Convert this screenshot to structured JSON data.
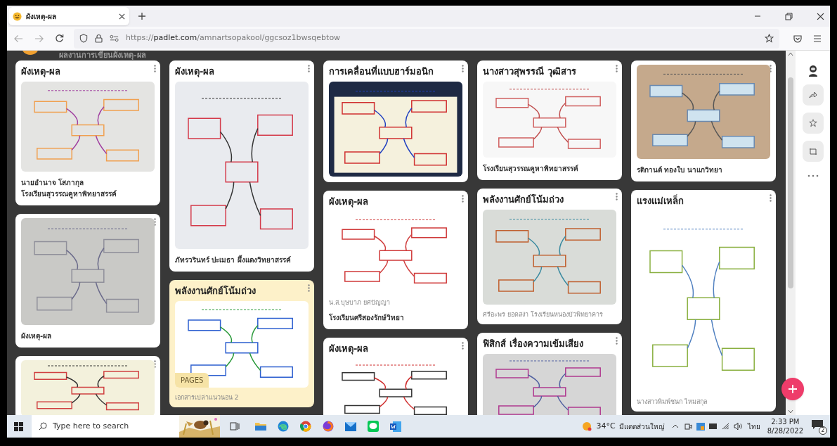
{
  "browser": {
    "tab": {
      "title": "ผังเหตุ-ผล",
      "selected": true
    },
    "url": "https://**padlet.com**/amnartsopakool/ggcsoz1bwsqebtow"
  },
  "board": {
    "subtitle": "ผลงานการเขียนผังเหตุ-ผล",
    "columns": [
      {
        "posts": [
          {
            "title": "ผังเหตุ-ผล",
            "image": {
              "kind": "picture"
            },
            "caption": [
              "นายอำนาจ โสภากุล",
              "โรงเรียนสุวรรณคูหาพิทยาสรรค์"
            ]
          },
          {
            "image": {
              "kind": "picture"
            },
            "caption": [
              "ผังเหตุ-ผล"
            ]
          },
          {
            "image": {
              "kind": "picture"
            }
          }
        ]
      },
      {
        "posts": [
          {
            "title": "ผังเหตุ-ผล",
            "image": {
              "kind": "picture"
            },
            "caption": [
              "ภัทรวรินทร์ ปะเมธา ผึ้งแดงวิทยาสรรค์"
            ]
          },
          {
            "title": "พลังงานศักย์โน้มถ่วง",
            "color": "#fdf1c9",
            "image": {
              "kind": "picture"
            },
            "badge": "PAGES",
            "note": "เอกสารเปล่าแนวนอน 2"
          }
        ]
      },
      {
        "posts": [
          {
            "title": "การเคลื่อนที่แบบฮาร์มอนิก",
            "image": {
              "kind": "picture"
            }
          },
          {
            "title": "ผังเหตุ-ผล",
            "image": {
              "kind": "picture"
            },
            "note": "น.ส.บุษบาภ ยศปัญญา",
            "caption": [
              "โรงเรียนศรีสองรักษ์วิทยา"
            ]
          },
          {
            "title": "ผังเหตุ-ผล",
            "image": {
              "kind": "picture"
            }
          }
        ]
      },
      {
        "posts": [
          {
            "title": "นางสาวสุพรรณี วุฒิสาร",
            "image": {
              "kind": "picture"
            },
            "caption": [
              "โรงเรียนสุวรรณคูหาพิทยาสรรค์"
            ]
          },
          {
            "title": "พลังงานศักย์โน้มถ่วง",
            "image": {
              "kind": "picture"
            },
            "note": "ศรีอะพร ยอดสง่า โรงเรียนหนองบัวพิทยาคาร"
          },
          {
            "title": "ฟิสิกส์ เรื่องความเข้มเสียง",
            "image": {
              "kind": "picture"
            }
          }
        ]
      },
      {
        "posts": [
          {
            "image": {
              "kind": "picture"
            },
            "caption": [
              "รติกานต์ ทองใบ นาแกวิทยา"
            ]
          },
          {
            "title": "แรงแม่เหล็ก",
            "image": {
              "kind": "picture"
            },
            "note": "นางสาวพิมพ์ชนก ไหมสกุล"
          }
        ]
      }
    ]
  },
  "taskbar": {
    "search": {
      "placeholder": "Type here to search"
    },
    "weather": {
      "temperature": "34°C",
      "condition": "มีแดดส่วนใหญ่"
    },
    "language": "ไทย",
    "time": "2:33 PM",
    "date": "8/28/2022",
    "notifications": "2"
  }
}
